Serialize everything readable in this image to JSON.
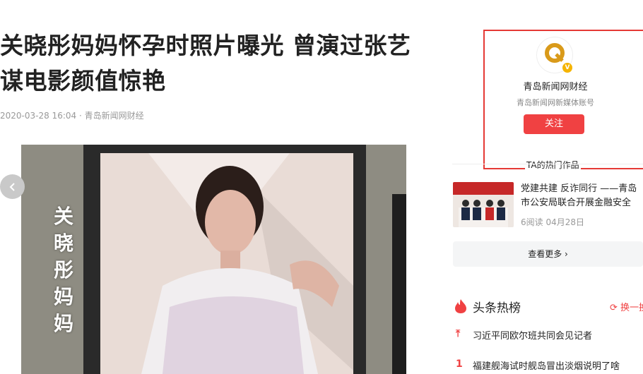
{
  "article": {
    "title": "关晓彤妈妈怀孕时照片曝光 曾演过张艺谋电影颜值惊艳",
    "meta": "2020-03-28 16:04 · 青岛新闻网财经",
    "photo_caption": "关晓彤妈妈"
  },
  "author": {
    "name": "青岛新闻网财经",
    "description": "青岛新闻网新媒体账号",
    "follow_label": "关注",
    "hot_works_label": "TA的热门作品"
  },
  "related": {
    "title": "党建共建 反诈同行 ——青岛市公安局联合开展金融安全",
    "meta": "6阅读    04月28日",
    "more_label": "查看更多 ›"
  },
  "hot_list": {
    "title": "头条热榜",
    "refresh_label": "换一换",
    "items": [
      {
        "rank": "⤒",
        "text": "习近平同欧尔班共同会见记者"
      },
      {
        "rank": "1",
        "text": "福建舰海试时舰岛冒出淡烟说明了啥"
      }
    ]
  },
  "colors": {
    "accent": "#f04142",
    "highlight_border": "#e53935"
  }
}
